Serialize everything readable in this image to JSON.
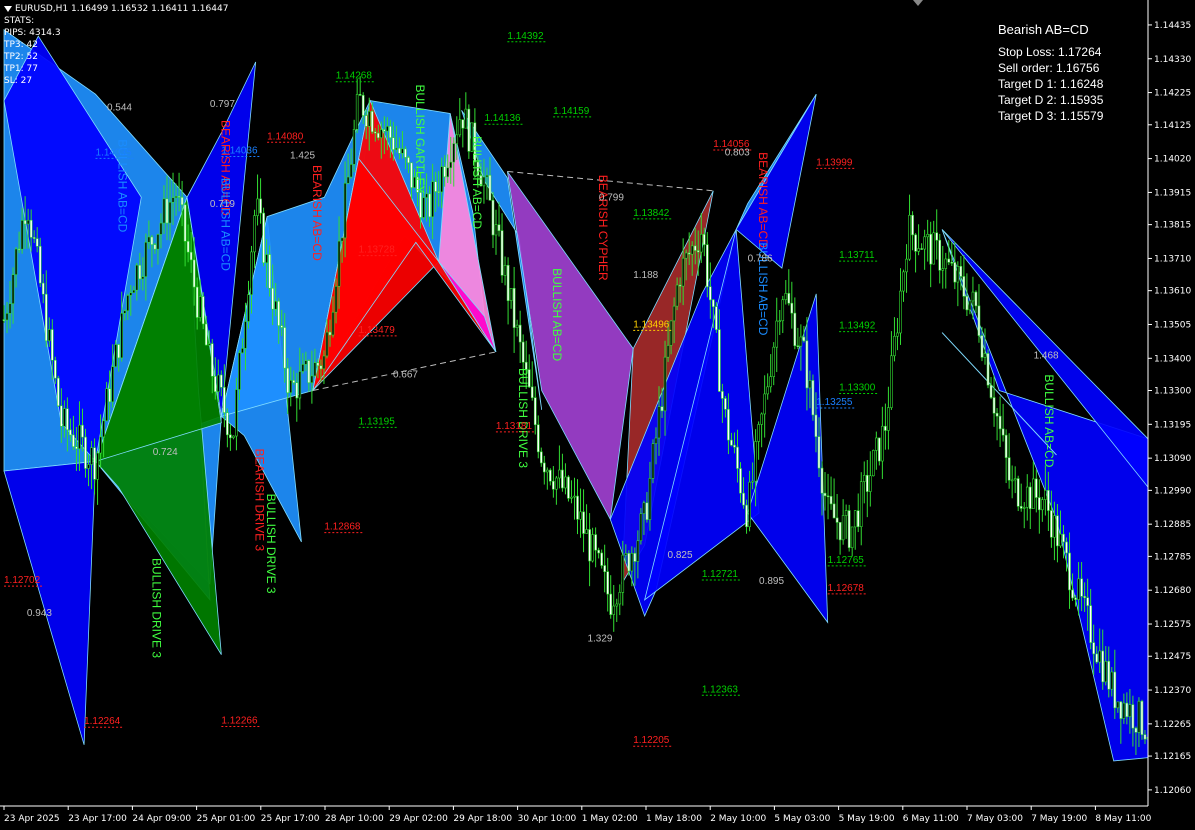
{
  "header": {
    "symbol_line": "EURUSD,H1  1.16499  1.16532  1.16411  1.16447",
    "stats_lines": [
      "STATS:",
      "PIPS: 4314.3",
      "TP3: 42",
      "TP2: 52",
      "TP1: 77",
      "SL: 27"
    ]
  },
  "info_panel": {
    "title": "Bearish AB=CD",
    "lines": [
      "Stop Loss: 1.17264",
      "Sell order: 1.16756",
      "Target D 1: 1.16248",
      "Target D 2: 1.15935",
      "Target D 3: 1.15579"
    ]
  },
  "chart_data": {
    "type": "candlestick",
    "instrument": "EURUSD",
    "timeframe": "H1",
    "ylim": [
      1.1201,
      1.145
    ],
    "y_ticks": [
      "1.14435",
      "1.14330",
      "1.14225",
      "1.14125",
      "1.14020",
      "1.13915",
      "1.13815",
      "1.13710",
      "1.13610",
      "1.13505",
      "1.13400",
      "1.13300",
      "1.13195",
      "1.13090",
      "1.12990",
      "1.12885",
      "1.12785",
      "1.12680",
      "1.12575",
      "1.12475",
      "1.12370",
      "1.12265",
      "1.12165",
      "1.12060"
    ],
    "x_ticks": [
      "23 Apr 2025",
      "23 Apr 17:00",
      "24 Apr 09:00",
      "25 Apr 01:00",
      "25 Apr 17:00",
      "28 Apr 10:00",
      "29 Apr 02:00",
      "29 Apr 18:00",
      "30 Apr 10:00",
      "1 May 02:00",
      "1 May 18:00",
      "2 May 10:00",
      "5 May 03:00",
      "5 May 19:00",
      "6 May 11:00",
      "7 May 03:00",
      "7 May 19:00",
      "8 May 11:00"
    ],
    "close_path": [
      [
        0,
        1.1352
      ],
      [
        0.02,
        1.139
      ],
      [
        0.05,
        1.132
      ],
      [
        0.08,
        1.1308
      ],
      [
        0.11,
        1.1363
      ],
      [
        0.15,
        1.1392
      ],
      [
        0.18,
        1.1338
      ],
      [
        0.2,
        1.1316
      ],
      [
        0.22,
        1.1388
      ],
      [
        0.25,
        1.133
      ],
      [
        0.28,
        1.134
      ],
      [
        0.31,
        1.142
      ],
      [
        0.34,
        1.1408
      ],
      [
        0.37,
        1.1385
      ],
      [
        0.4,
        1.1417
      ],
      [
        0.42,
        1.1395
      ],
      [
        0.44,
        1.1362
      ],
      [
        0.47,
        1.131
      ],
      [
        0.5,
        1.1293
      ],
      [
        0.53,
        1.1265
      ],
      [
        0.56,
        1.129
      ],
      [
        0.59,
        1.1366
      ],
      [
        0.61,
        1.138
      ],
      [
        0.63,
        1.1322
      ],
      [
        0.65,
        1.1292
      ],
      [
        0.68,
        1.1362
      ],
      [
        0.7,
        1.134
      ],
      [
        0.72,
        1.1292
      ],
      [
        0.74,
        1.1286
      ],
      [
        0.77,
        1.1318
      ],
      [
        0.79,
        1.138
      ],
      [
        0.82,
        1.1371
      ],
      [
        0.85,
        1.1355
      ],
      [
        0.88,
        1.13
      ],
      [
        0.91,
        1.1296
      ],
      [
        0.94,
        1.1265
      ],
      [
        0.97,
        1.1236
      ],
      [
        1.0,
        1.1225
      ]
    ],
    "price_labels": [
      {
        "text": "1.14392",
        "color": "#00d000",
        "x": 0.44,
        "y": 1.14392
      },
      {
        "text": "1.14268",
        "color": "#00d000",
        "x": 0.29,
        "y": 1.14268
      },
      {
        "text": "1.14159",
        "color": "#00d000",
        "x": 0.48,
        "y": 1.14159
      },
      {
        "text": "1.14136",
        "color": "#00d000",
        "x": 0.42,
        "y": 1.14136
      },
      {
        "text": "1.14080",
        "color": "#ff2020",
        "x": 0.23,
        "y": 1.1408
      },
      {
        "text": "1.14056",
        "color": "#ff2020",
        "x": 0.62,
        "y": 1.14056
      },
      {
        "text": "1.14036",
        "color": "#1a80ff",
        "x": 0.19,
        "y": 1.14036
      },
      {
        "text": "1.14035",
        "color": "#1a80ff",
        "x": 0.08,
        "y": 1.1403
      },
      {
        "text": "1.13999",
        "color": "#ff2020",
        "x": 0.71,
        "y": 1.13999
      },
      {
        "text": "1.13842",
        "color": "#00d000",
        "x": 0.55,
        "y": 1.13842
      },
      {
        "text": "1.13728",
        "color": "#ff2020",
        "x": 0.31,
        "y": 1.13728
      },
      {
        "text": "1.13711",
        "color": "#00d000",
        "x": 0.73,
        "y": 1.13711
      },
      {
        "text": "1.13496",
        "color": "#ffd000",
        "x": 0.55,
        "y": 1.13496
      },
      {
        "text": "1.13492",
        "color": "#00d000",
        "x": 0.73,
        "y": 1.13492
      },
      {
        "text": "1.13479",
        "color": "#ff2020",
        "x": 0.31,
        "y": 1.13479
      },
      {
        "text": "1.13300",
        "color": "#00d000",
        "x": 0.73,
        "y": 1.133
      },
      {
        "text": "1.13255",
        "color": "#1a80ff",
        "x": 0.71,
        "y": 1.13255
      },
      {
        "text": "1.13195",
        "color": "#00d000",
        "x": 0.31,
        "y": 1.13195
      },
      {
        "text": "1.13181",
        "color": "#ff2020",
        "x": 0.43,
        "y": 1.13181
      },
      {
        "text": "1.12868",
        "color": "#ff2020",
        "x": 0.28,
        "y": 1.12868
      },
      {
        "text": "1.12765",
        "color": "#00d000",
        "x": 0.72,
        "y": 1.12765
      },
      {
        "text": "1.12721",
        "color": "#00d000",
        "x": 0.61,
        "y": 1.12721
      },
      {
        "text": "1.12702",
        "color": "#ff2020",
        "x": 0.0,
        "y": 1.12702
      },
      {
        "text": "1.12678",
        "color": "#ff2020",
        "x": 0.72,
        "y": 1.12678
      },
      {
        "text": "1.12363",
        "color": "#00d000",
        "x": 0.61,
        "y": 1.12363
      },
      {
        "text": "1.12266",
        "color": "#ff2020",
        "x": 0.19,
        "y": 1.12266
      },
      {
        "text": "1.12264",
        "color": "#ff2020",
        "x": 0.07,
        "y": 1.12264
      },
      {
        "text": "1.12205",
        "color": "#ff2020",
        "x": 0.55,
        "y": 1.12205
      }
    ],
    "patterns": [
      {
        "name": "BULLISH AB=CD",
        "color": "#1a8cff",
        "x": 0.1,
        "y": 1.1408
      },
      {
        "name": "BEARISH AB=CD",
        "color": "#ff2020",
        "x": 0.19,
        "y": 1.1414
      },
      {
        "name": "BULLISH AB=CD",
        "color": "#1a8cff",
        "x": 0.19,
        "y": 1.1396
      },
      {
        "name": "BEARISH AB=CD",
        "color": "#ff2020",
        "x": 0.27,
        "y": 1.14
      },
      {
        "name": "BULLISH GARTLEY",
        "color": "#40ff40",
        "x": 0.36,
        "y": 1.1425
      },
      {
        "name": "BULLISH AB=CD",
        "color": "#40ff40",
        "x": 0.41,
        "y": 1.1409
      },
      {
        "name": "BEARISH CYPHER",
        "color": "#ff2020",
        "x": 0.52,
        "y": 1.1397
      },
      {
        "name": "BULLISH AB=CD",
        "color": "#40ff40",
        "x": 0.48,
        "y": 1.1368
      },
      {
        "name": "BULLISH DRIVE 3",
        "color": "#40ff40",
        "x": 0.45,
        "y": 1.1337
      },
      {
        "name": "BEARISH DRIVE 3",
        "color": "#ff2020",
        "x": 0.22,
        "y": 1.1312
      },
      {
        "name": "BULLISH DRIVE 3",
        "color": "#40ff40",
        "x": 0.23,
        "y": 1.1298
      },
      {
        "name": "BULLISH DRIVE 3",
        "color": "#40ff40",
        "x": 0.13,
        "y": 1.1278
      },
      {
        "name": "BEARISH AB=CD",
        "color": "#ff2020",
        "x": 0.66,
        "y": 1.1404
      },
      {
        "name": "BULLISH AB=CD",
        "color": "#1a8cff",
        "x": 0.66,
        "y": 1.1376
      },
      {
        "name": "BULLISH AB=CD",
        "color": "#40ff40",
        "x": 0.91,
        "y": 1.1335
      }
    ],
    "ratio_labels": [
      {
        "text": "0.544",
        "x": 0.09,
        "y": 1.1417
      },
      {
        "text": "0.797",
        "x": 0.18,
        "y": 1.1418
      },
      {
        "text": "1.425",
        "x": 0.25,
        "y": 1.1402
      },
      {
        "text": "0.719",
        "x": 0.18,
        "y": 1.1387
      },
      {
        "text": "0.799",
        "x": 0.52,
        "y": 1.1389
      },
      {
        "text": "1.188",
        "x": 0.55,
        "y": 1.1365
      },
      {
        "text": "0.803",
        "x": 0.63,
        "y": 1.1403
      },
      {
        "text": "0.786",
        "x": 0.65,
        "y": 1.137
      },
      {
        "text": "0.667",
        "x": 0.34,
        "y": 1.1334
      },
      {
        "text": "0.724",
        "x": 0.13,
        "y": 1.131
      },
      {
        "text": "0.825",
        "x": 0.58,
        "y": 1.1278
      },
      {
        "text": "0.895",
        "x": 0.66,
        "y": 1.127
      },
      {
        "text": "1.329",
        "x": 0.51,
        "y": 1.1252
      },
      {
        "text": "0.943",
        "x": 0.02,
        "y": 1.126
      },
      {
        "text": "1.468",
        "x": 0.9,
        "y": 1.134
      }
    ],
    "xlabel": "",
    "ylabel": "",
    "grid": false
  }
}
